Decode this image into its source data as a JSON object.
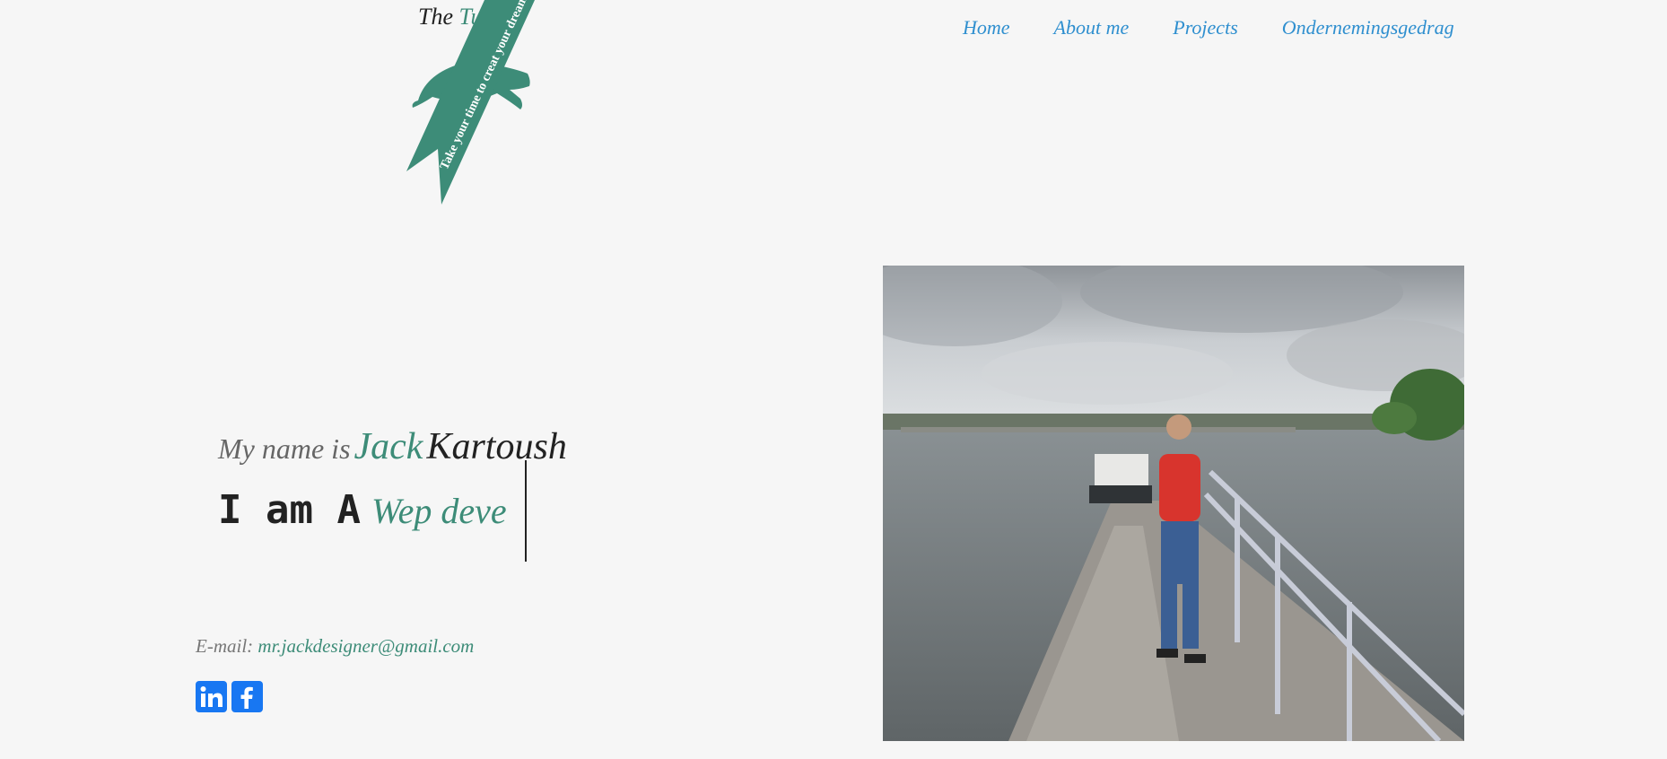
{
  "brand": {
    "title_prefix": "The",
    "title_accent": "Turtle",
    "ribbon_text": "Take your time to creat your dreams",
    "logo_icon": "turtle-icon"
  },
  "nav": {
    "items": [
      {
        "label": "Home"
      },
      {
        "label": "About me"
      },
      {
        "label": "Projects"
      },
      {
        "label": "Ondernemingsgedrag"
      }
    ]
  },
  "hero": {
    "intro_lead": "My name is",
    "first_name": "Jack",
    "last_name": "Kartoush",
    "role_prefix": "I am A",
    "role_typed": "Wep deve"
  },
  "contact": {
    "email_label": "E-mail:",
    "email": "mr.jackdesigner@gmail.com"
  },
  "social": [
    {
      "icon": "linkedin-icon"
    },
    {
      "icon": "facebook-icon"
    }
  ],
  "colors": {
    "accent": "#3d8c78",
    "nav_link": "#2f8fcf",
    "social": "#1877f2",
    "background": "#f6f6f6"
  }
}
